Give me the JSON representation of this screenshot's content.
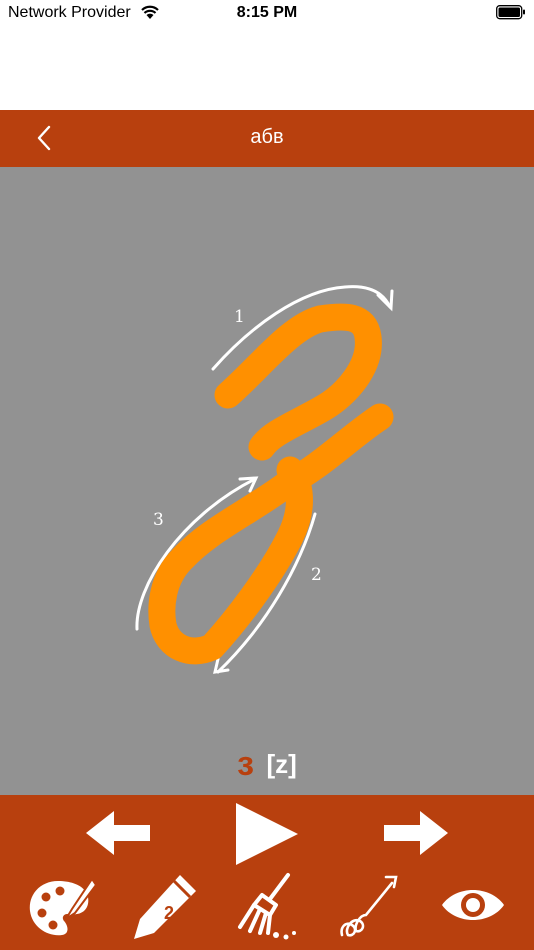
{
  "status_bar": {
    "carrier": "Network Provider",
    "time": "8:15 PM"
  },
  "nav": {
    "title": "абв"
  },
  "letter": {
    "glyph": "з",
    "sound": "[z]",
    "stroke_numbers": [
      "1",
      "2",
      "3"
    ]
  },
  "toolbar": {
    "pencil_size": "2"
  },
  "colors": {
    "brand": "#b8400e",
    "canvas": "#929292",
    "drawing": "#ff9000",
    "guide": "#ffffff"
  },
  "icons": {
    "back": "chevron-left-icon",
    "prev": "arrow-left-icon",
    "play": "play-icon",
    "next": "arrow-right-icon",
    "palette": "palette-icon",
    "pencil": "pencil-icon",
    "clear": "broom-icon",
    "trace": "trace-path-icon",
    "view": "eye-icon"
  }
}
